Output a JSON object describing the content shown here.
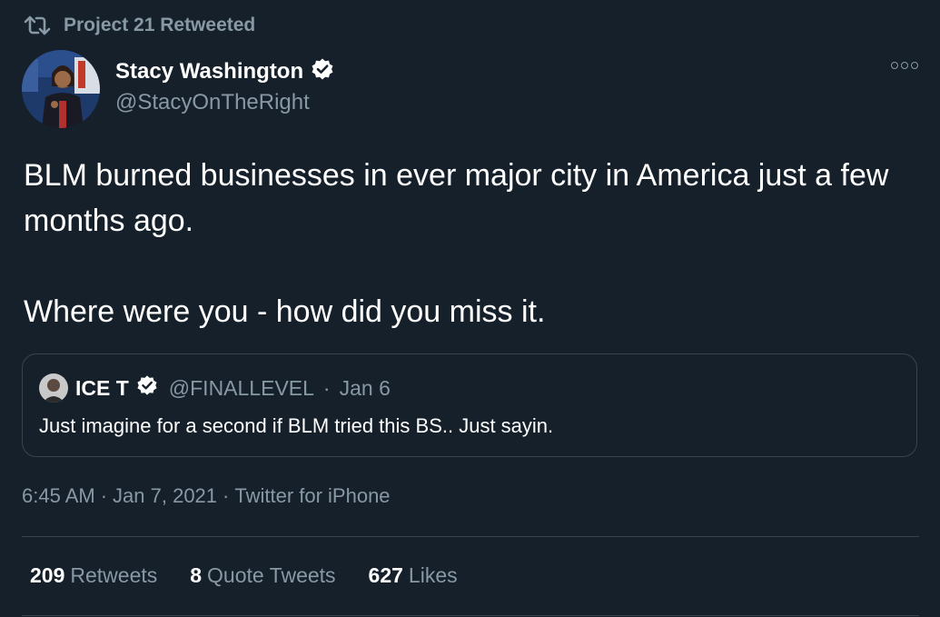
{
  "retweet": {
    "label": "Project 21 Retweeted",
    "icon": "retweet-icon"
  },
  "author": {
    "name": "Stacy Washington",
    "handle": "@StacyOnTheRight",
    "verified_icon": "verified-badge-icon"
  },
  "more_icon": "more-options-icon",
  "tweet": {
    "text_line1": "BLM burned businesses in ever major city in America just a few months ago.",
    "text_line2": "Where were you - how did you miss it."
  },
  "quoted_tweet": {
    "name": "ICE T",
    "handle": "@FINALLEVEL",
    "separator": "·",
    "date": "Jan 6",
    "text": "Just imagine for a second if BLM tried this BS..  Just sayin."
  },
  "meta": {
    "time": "6:45 AM",
    "sep1": "·",
    "date": "Jan 7, 2021",
    "sep2": "·",
    "source": "Twitter for iPhone"
  },
  "stats": {
    "retweets_count": "209",
    "retweets_label": "Retweets",
    "quotes_count": "8",
    "quotes_label": "Quote Tweets",
    "likes_count": "627",
    "likes_label": "Likes"
  },
  "colors": {
    "background": "#15202b",
    "primary_text": "#ffffff",
    "secondary_text": "#8899a6",
    "border": "#38444d"
  }
}
